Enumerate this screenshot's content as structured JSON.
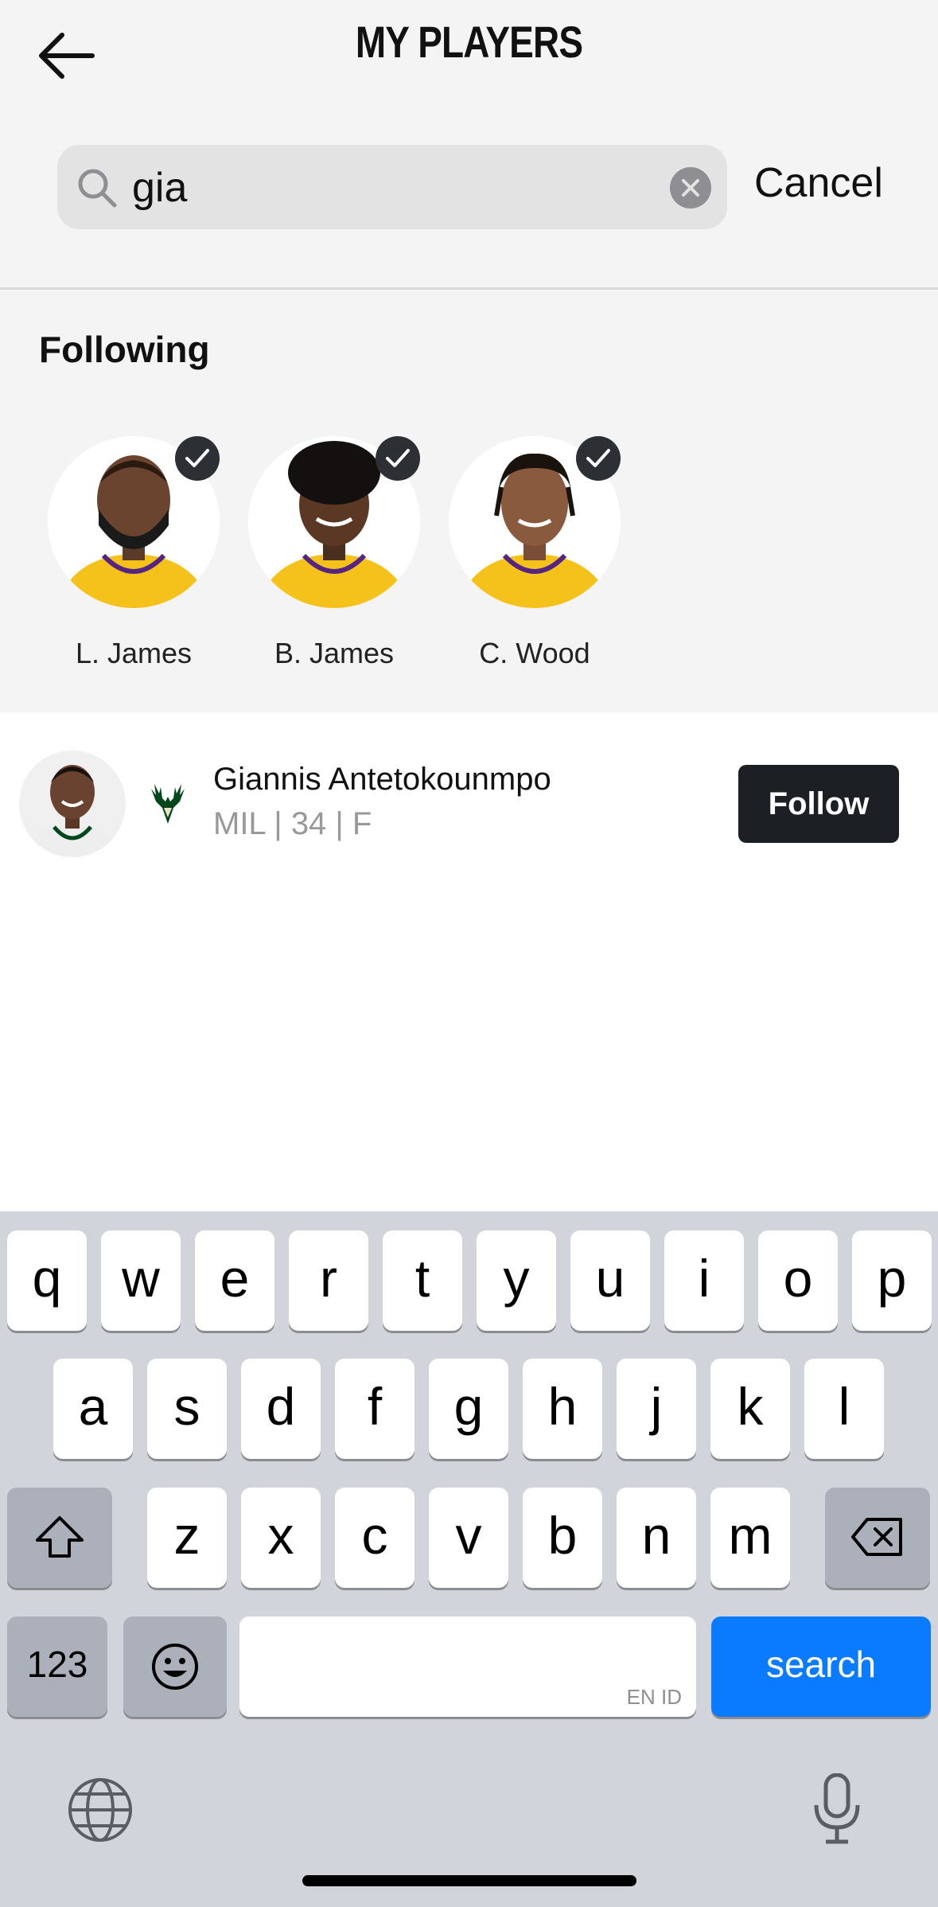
{
  "header": {
    "title": "MY PLAYERS",
    "back_icon": "arrow-left-icon"
  },
  "search": {
    "value": "gia",
    "cancel_label": "Cancel"
  },
  "following": {
    "heading": "Following",
    "players": [
      {
        "name": "L. James"
      },
      {
        "name": "B. James"
      },
      {
        "name": "C. Wood"
      }
    ]
  },
  "results": [
    {
      "name": "Giannis Antetokounmpo",
      "info": "MIL | 34 | F",
      "action": "Follow"
    }
  ],
  "keyboard": {
    "row1": [
      "q",
      "w",
      "e",
      "r",
      "t",
      "y",
      "u",
      "i",
      "o",
      "p"
    ],
    "row2": [
      "a",
      "s",
      "d",
      "f",
      "g",
      "h",
      "j",
      "k",
      "l"
    ],
    "row3": [
      "z",
      "x",
      "c",
      "v",
      "b",
      "n",
      "m"
    ],
    "numbers_label": "123",
    "language_hint": "EN ID",
    "search_label": "search"
  },
  "colors": {
    "accent": "#0a7aff",
    "button_dark": "#1c1f23",
    "jersey_gold": "#f5c21b",
    "bucks_green": "#00471b"
  }
}
